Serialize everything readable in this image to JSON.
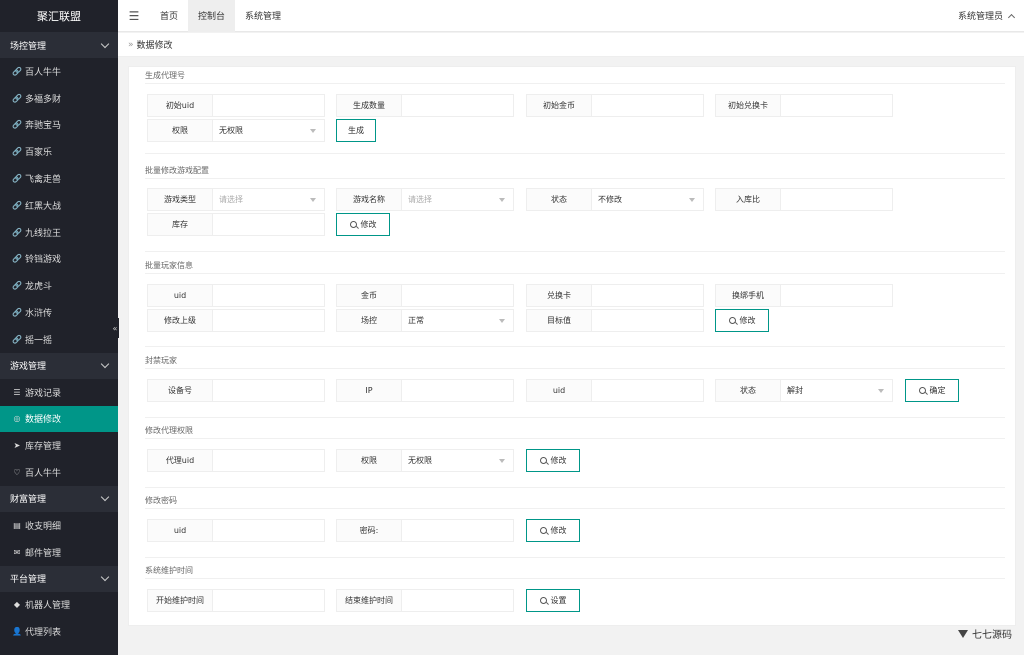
{
  "app": {
    "title": "聚汇联盟"
  },
  "sidebar": {
    "groups": [
      {
        "label": "场控管理",
        "items": [
          {
            "icon": "link-icon",
            "label": "百人牛牛"
          },
          {
            "icon": "link-icon",
            "label": "多福多财"
          },
          {
            "icon": "link-icon",
            "label": "奔驰宝马"
          },
          {
            "icon": "link-icon",
            "label": "百家乐"
          },
          {
            "icon": "link-icon",
            "label": "飞禽走兽"
          },
          {
            "icon": "link-icon",
            "label": "红黑大战"
          },
          {
            "icon": "link-icon",
            "label": "九线拉王"
          },
          {
            "icon": "link-icon",
            "label": "铃铛游戏"
          },
          {
            "icon": "link-icon",
            "label": "龙虎斗"
          },
          {
            "icon": "link-icon",
            "label": "水浒传"
          },
          {
            "icon": "link-icon",
            "label": "摇一摇"
          }
        ]
      },
      {
        "label": "游戏管理",
        "items": [
          {
            "icon": "list-icon",
            "label": "游戏记录"
          },
          {
            "icon": "broadcast-icon",
            "label": "数据修改"
          },
          {
            "icon": "send-icon",
            "label": "库存管理"
          },
          {
            "icon": "heart-icon",
            "label": "百人牛牛"
          }
        ]
      },
      {
        "label": "财富管理",
        "items": [
          {
            "icon": "receipt-icon",
            "label": "收支明细"
          },
          {
            "icon": "mail-icon",
            "label": "邮件管理"
          }
        ]
      },
      {
        "label": "平台管理",
        "items": [
          {
            "icon": "diamond-icon",
            "label": "机器人管理"
          },
          {
            "icon": "user-icon",
            "label": "代理列表"
          }
        ]
      }
    ],
    "active_item": "数据修改"
  },
  "header": {
    "tabs": [
      "首页",
      "控制台",
      "系统管理"
    ],
    "active_tab": "控制台",
    "user": "系统管理员"
  },
  "breadcrumb": "数据修改",
  "sections": {
    "agent": {
      "title": "生成代理号",
      "f1": "初始uid",
      "f2": "生成数量",
      "f3": "初始金币",
      "f4": "初始兑换卡",
      "f5": "权限",
      "f5_val": "无权限",
      "btn": "生成"
    },
    "game": {
      "title": "批量修改游戏配置",
      "f1": "游戏类型",
      "f1_ph": "请选择",
      "f2": "游戏名称",
      "f2_ph": "请选择",
      "f3": "状态",
      "f3_val": "不修改",
      "f4": "入库比",
      "f5": "库存",
      "btn": "修改"
    },
    "player": {
      "title": "批量玩家信息",
      "f1": "uid",
      "f2": "金币",
      "f3": "兑换卡",
      "f4": "换绑手机",
      "f5": "修改上级",
      "f6": "场控",
      "f6_val": "正常",
      "f7": "目标值",
      "btn": "修改"
    },
    "ban": {
      "title": "封禁玩家",
      "f1": "设备号",
      "f2": "IP",
      "f3": "uid",
      "f4": "状态",
      "f4_val": "解封",
      "btn": "确定"
    },
    "perm": {
      "title": "修改代理权限",
      "f1": "代理uid",
      "f2": "权限",
      "f2_val": "无权限",
      "btn": "修改"
    },
    "pwd": {
      "title": "修改密码",
      "f1": "uid",
      "f2": "密码:",
      "btn": "修改"
    },
    "maint": {
      "title": "系统维护时间",
      "f1": "开始维护时间",
      "f2": "结束维护时间",
      "btn": "设置"
    }
  },
  "watermark": "七七源码"
}
